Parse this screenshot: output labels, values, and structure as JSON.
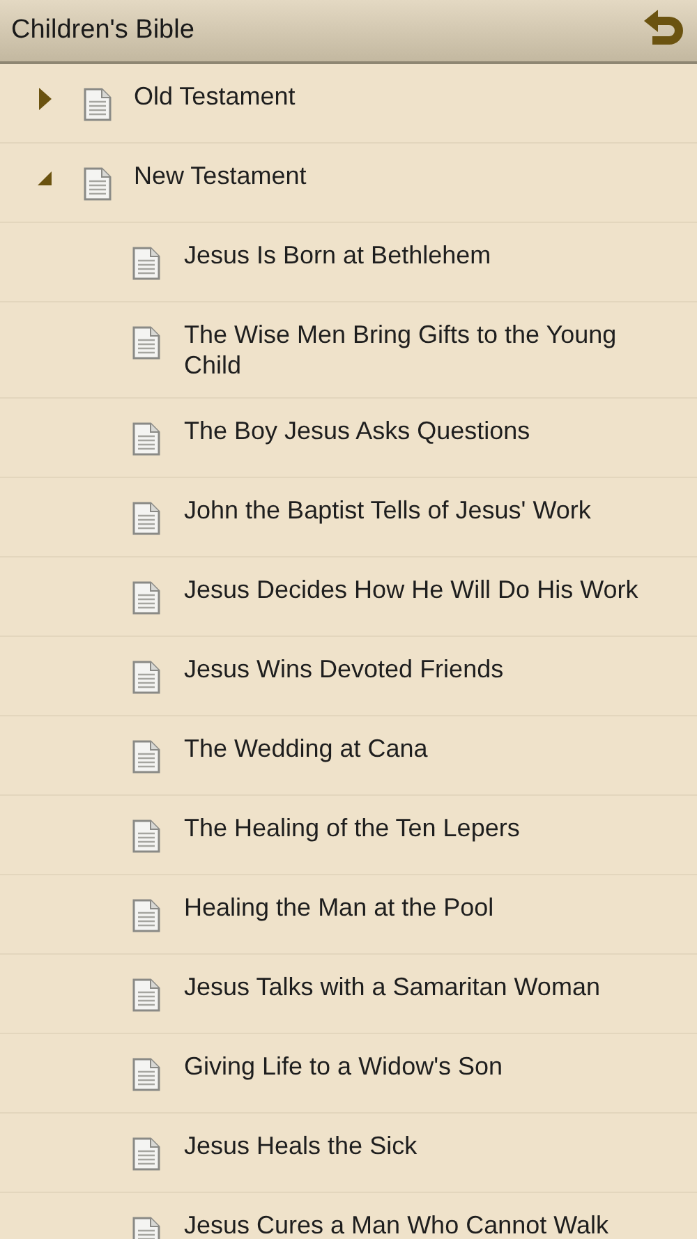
{
  "title_bar": {
    "title": "Children's Bible"
  },
  "tree": [
    {
      "label": "Old Testament",
      "expanded": false
    },
    {
      "label": "New Testament",
      "expanded": true,
      "children": [
        {
          "label": "Jesus Is Born at Bethlehem"
        },
        {
          "label": "The Wise Men Bring Gifts to the Young Child"
        },
        {
          "label": "The Boy Jesus Asks Questions"
        },
        {
          "label": "John the Baptist Tells of Jesus' Work"
        },
        {
          "label": "Jesus Decides How He Will Do His Work"
        },
        {
          "label": "Jesus Wins Devoted Friends"
        },
        {
          "label": "The Wedding at Cana"
        },
        {
          "label": "The Healing of the Ten Lepers"
        },
        {
          "label": "Healing the Man at the Pool"
        },
        {
          "label": "Jesus Talks with a Samaritan Woman"
        },
        {
          "label": "Giving Life to a Widow's Son"
        },
        {
          "label": "Jesus Heals the Sick"
        },
        {
          "label": "Jesus Cures a Man Who Cannot Walk"
        }
      ]
    }
  ]
}
